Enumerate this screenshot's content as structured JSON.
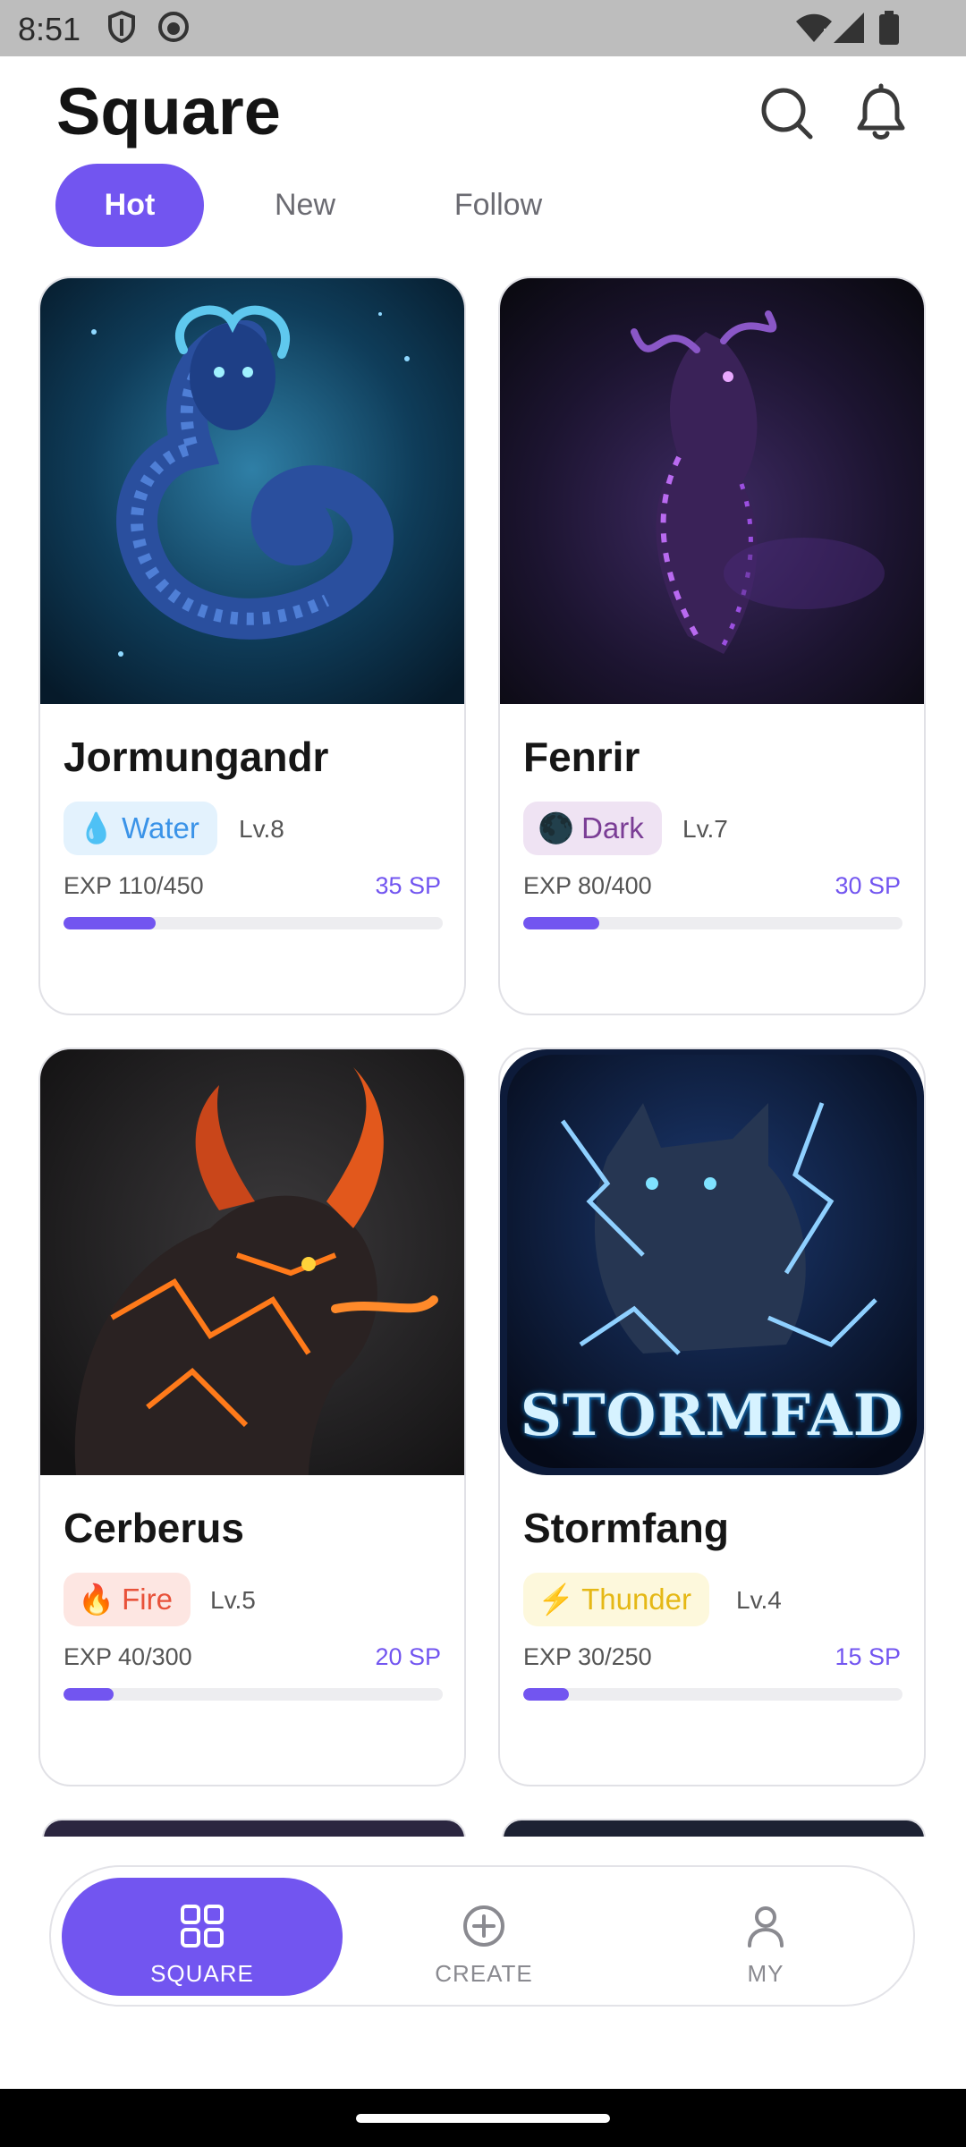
{
  "status_bar": {
    "time": "8:51"
  },
  "header": {
    "title": "Square"
  },
  "tabs": [
    {
      "label": "Hot",
      "active": true
    },
    {
      "label": "New",
      "active": false
    },
    {
      "label": "Follow",
      "active": false
    }
  ],
  "cards": [
    {
      "name": "Jormungandr",
      "element": "Water",
      "element_icon": "water-drop-icon",
      "level": "Lv.8",
      "exp": "EXP 110/450",
      "sp": "35 SP",
      "progress": 0.244,
      "element_bg": "#e3f2fd",
      "element_color": "#3a93e8"
    },
    {
      "name": "Fenrir",
      "element": "Dark",
      "element_icon": "dark-moon-icon",
      "level": "Lv.7",
      "exp": "EXP 80/400",
      "sp": "30 SP",
      "progress": 0.2,
      "element_bg": "#efe3f3",
      "element_color": "#7a3d95"
    },
    {
      "name": "Cerberus",
      "element": "Fire",
      "element_icon": "fire-icon",
      "level": "Lv.5",
      "exp": "EXP 40/300",
      "sp": "20 SP",
      "progress": 0.133,
      "element_bg": "#fde6e2",
      "element_color": "#e8523a"
    },
    {
      "name": "Stormfang",
      "element": "Thunder",
      "element_icon": "lightning-icon",
      "level": "Lv.4",
      "exp": "EXP 30/250",
      "sp": "15 SP",
      "progress": 0.12,
      "element_bg": "#fdf8dc",
      "element_color": "#e5b816",
      "art_text": "STORMFAD"
    }
  ],
  "bottom_nav": [
    {
      "label": "SQUARE",
      "icon": "grid-icon",
      "active": true
    },
    {
      "label": "CREATE",
      "icon": "plus-circle-icon",
      "active": false
    },
    {
      "label": "MY",
      "icon": "person-icon",
      "active": false
    }
  ],
  "colors": {
    "accent": "#7255f0"
  }
}
